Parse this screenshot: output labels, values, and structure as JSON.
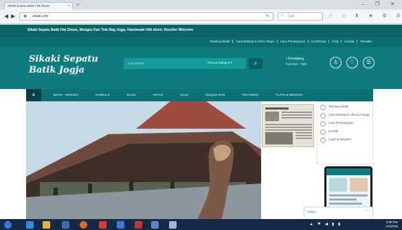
{
  "browser": {
    "tab_title": "Sikaki Sepatu Batik Flat Shoes",
    "tab_close": "×",
    "new_tab": "+",
    "window_controls": "– ❐ ✕",
    "url": "sikaki.com",
    "search_placeholder": "Cari",
    "toolbar_icons": "☆ ⌂ ⬇ ★ ⚙ ☰"
  },
  "site": {
    "top_strip": "Sikaki Sepatu Batik Flat Shoes, Wedges Dan Tote Bag Jogja, Handmade Klik disini, Reseller Welcome",
    "top_links": [
      "Tentang Sikaki",
      "Cara Belanja & Kirim Harga",
      "Cara Pembayaran",
      "Konfirmasi",
      "FAQ",
      "Kontak",
      "Reseller"
    ],
    "logo_line1": "Sikaki Sepatu",
    "logo_line2": "Batik Jogja",
    "search_placeholder": "Cari produk",
    "search_category": "Semua Kategori ▾",
    "search_button": "⌕",
    "cart_title": "• Keranjang",
    "cart_sub": "0 produk - Rp0,-",
    "header_icons": [
      "user-icon",
      "heart-icon",
      "menu-icon"
    ],
    "menu_home": "≡",
    "menu_items": [
      "BATIK - GENDES",
      "SANDALS",
      "BAGS",
      "ARTCS",
      "SALE",
      "UNIQUE RUN",
      "FEATURED",
      "FLATS & WEDGES"
    ],
    "side_menu": [
      "Tentang Sikaki",
      "Cara Belanja & Ukuran Harga",
      "Cara Pembayaran",
      "Kontak",
      "Login & Register"
    ],
    "chat_label": "Online",
    "chat_min": "–"
  },
  "taskbar": {
    "clock_time": "4:08 PM",
    "clock_date": "1/4/2016",
    "tray_icons": "▲ ⚑ ◀ ▮ ▮"
  },
  "colors": {
    "brand_dark": "#0a6466",
    "brand": "#0f7d80",
    "taskbar": "#152a46"
  }
}
